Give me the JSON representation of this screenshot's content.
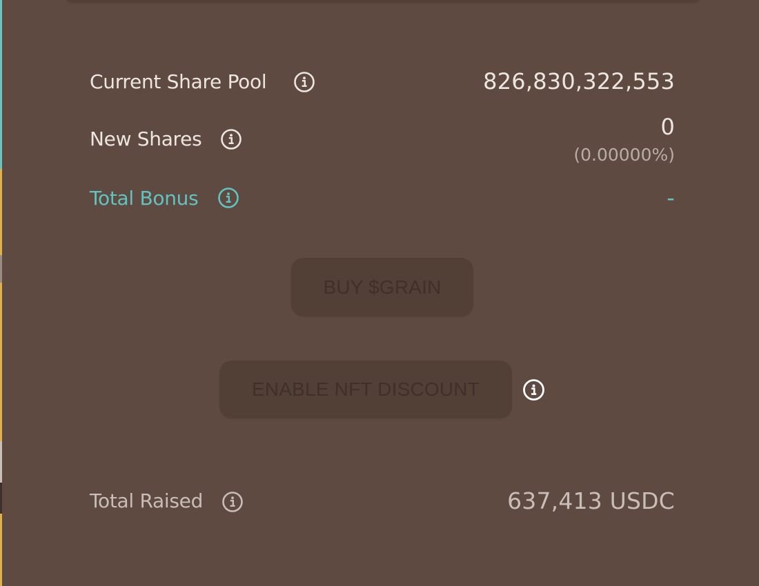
{
  "stats": {
    "current_share_pool_label": "Current Share Pool",
    "current_share_pool_value": "826,830,322,553",
    "new_shares_label": "New Shares",
    "new_shares_value": "0",
    "new_shares_percent": "(0.00000%)",
    "total_bonus_label": "Total Bonus",
    "total_bonus_value": "-",
    "total_raised_label": "Total Raised",
    "total_raised_value": "637,413 USDC"
  },
  "actions": {
    "buy_label": "BUY $GRAIN",
    "nft_discount_label": "ENABLE NFT DISCOUNT"
  },
  "icons": {
    "info": "info-circle-icon"
  },
  "colors": {
    "background": "#5e4a40",
    "text": "#ece6e1",
    "accent": "#62c3c1",
    "muted": "#c9beb7",
    "button_disabled_bg": "#523f36",
    "button_disabled_text": "#40302a"
  }
}
